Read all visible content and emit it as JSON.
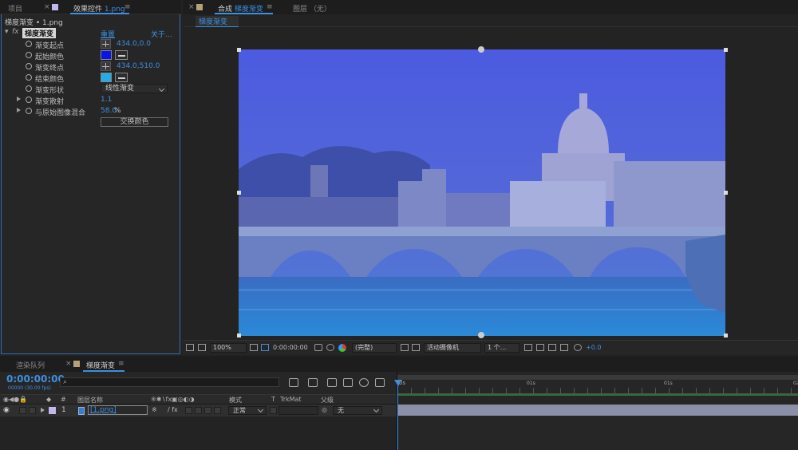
{
  "left_panel": {
    "tab_project": "项目",
    "tab_effects_prefix": "效果控件",
    "tab_effects_file": "1.png",
    "breadcrumb": "梯度渐变 • 1.png",
    "effect_name": "梯度渐变",
    "reset_label": "重置",
    "about_label": "关于...",
    "properties": [
      {
        "name": "渐变起点",
        "value": "434.0,0.0"
      },
      {
        "name": "起始颜色",
        "color": "#0a14e6"
      },
      {
        "name": "渐变终点",
        "value": "434.0,510.0"
      },
      {
        "name": "结束颜色",
        "color": "#21aee8"
      },
      {
        "name": "渐变形状",
        "value": "线性渐变"
      },
      {
        "name": "渐变散射",
        "value": "1.1"
      },
      {
        "name": "与原始图像混合",
        "value": "58.0",
        "unit": "%"
      }
    ],
    "swap_button": "交换颜色"
  },
  "comp_panel": {
    "tab_prefix": "合成",
    "tab_name": "梯度渐变",
    "tab_layer": "图层 （无）",
    "sub_tab": "梯度渐变",
    "toolbar": {
      "zoom": "100%",
      "timecode": "0:00:00:00",
      "resolution": "(完整)",
      "camera": "活动摄像机",
      "views": "1 个...",
      "exposure": "+0.0"
    }
  },
  "timeline": {
    "tab_render": "渲染队列",
    "tab_comp": "梯度渐变",
    "timecode": "0:00:00:00",
    "fps": "00000 (30.00 fps)",
    "search_placeholder": "",
    "columns": {
      "hash": "#",
      "layer_name": "图层名称",
      "mode": "模式",
      "t": "T",
      "trkmat": "TrkMat",
      "parent": "父级"
    },
    "layer": {
      "index": "1",
      "name": "[1.png]",
      "mode": "正常",
      "parent": "无"
    },
    "ruler": [
      "0s",
      "01s",
      "01s",
      "02"
    ]
  },
  "colors": {
    "accent": "#3d8fe0",
    "layer_bar": "#8b8fa8",
    "work_area": "#2f6e3a"
  }
}
